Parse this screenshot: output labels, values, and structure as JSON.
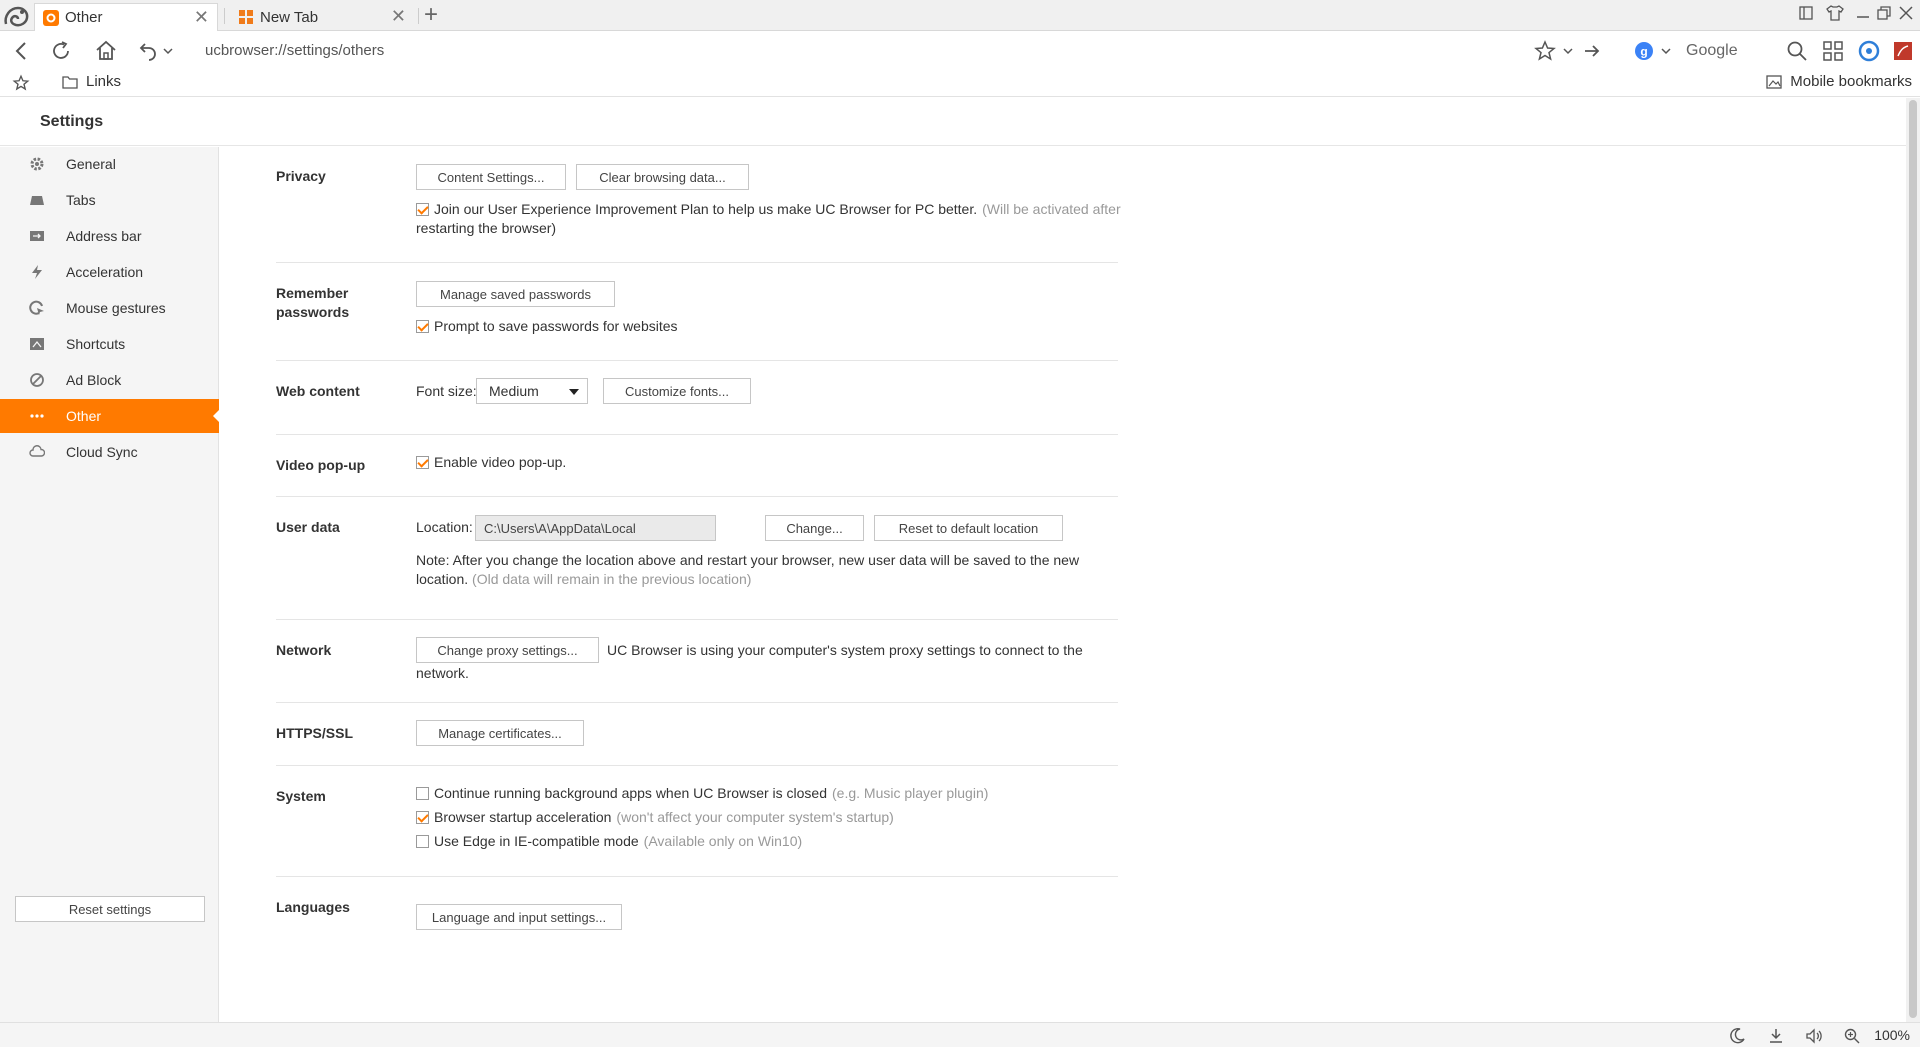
{
  "browser": {
    "tabs": [
      {
        "label": "Other",
        "icon": "gear-icon"
      },
      {
        "label": "New Tab",
        "icon": "grid-icon"
      }
    ],
    "url": "ucbrowser://settings/others",
    "search_engine": "Google",
    "bookmarks_bar": {
      "folder": "Links",
      "mobile": "Mobile bookmarks"
    },
    "status": {
      "zoom": "100%"
    }
  },
  "colors": {
    "accent": "#ff7a00"
  },
  "settings": {
    "title": "Settings",
    "sidebar": [
      {
        "label": "General",
        "icon": "gear-icon"
      },
      {
        "label": "Tabs",
        "icon": "tabs-icon"
      },
      {
        "label": "Address bar",
        "icon": "address-bar-icon"
      },
      {
        "label": "Acceleration",
        "icon": "lightning-icon"
      },
      {
        "label": "Mouse gestures",
        "icon": "mouse-gesture-icon"
      },
      {
        "label": "Shortcuts",
        "icon": "shortcuts-icon"
      },
      {
        "label": "Ad Block",
        "icon": "block-icon"
      },
      {
        "label": "Other",
        "icon": "more-dots-icon",
        "active": true
      },
      {
        "label": "Cloud Sync",
        "icon": "cloud-icon"
      }
    ],
    "reset_label": "Reset settings",
    "sections": {
      "privacy": {
        "label": "Privacy",
        "content_settings": "Content Settings...",
        "clear_data": "Clear browsing data...",
        "ux_plan": "Join our User Experience Improvement Plan to help us make UC Browser for PC better.",
        "ux_plan_note1": "(Will be activated after",
        "ux_plan_note2": "restarting the browser)",
        "ux_plan_checked": true
      },
      "passwords": {
        "label1": "Remember",
        "label2": "passwords",
        "manage": "Manage saved passwords",
        "prompt": "Prompt to save passwords for websites",
        "prompt_checked": true
      },
      "web_content": {
        "label": "Web content",
        "font_size_label": "Font size:",
        "font_size_value": "Medium",
        "customize": "Customize fonts..."
      },
      "video": {
        "label": "Video pop-up",
        "enable": "Enable video pop-up.",
        "enable_checked": true
      },
      "user_data": {
        "label": "User data",
        "location_label": "Location:",
        "location_value": "C:\\Users\\A\\AppData\\Local",
        "change": "Change...",
        "reset": "Reset to default location",
        "note_line1": "Note: After you change the location above and restart your browser, new user data will be saved to the new",
        "note_line2": "location.",
        "note_muted": "(Old data will remain in the previous location)"
      },
      "network": {
        "label": "Network",
        "proxy": "Change proxy settings...",
        "text_line1": "UC Browser is using your computer's system proxy settings to connect to the",
        "text_line2": "network."
      },
      "https": {
        "label": "HTTPS/SSL",
        "certs": "Manage certificates..."
      },
      "system": {
        "label": "System",
        "bg_apps": "Continue running background apps when UC Browser is closed",
        "bg_apps_note": "(e.g. Music player plugin)",
        "bg_apps_checked": false,
        "startup": "Browser startup acceleration",
        "startup_note": "(won't affect your computer system's startup)",
        "startup_checked": true,
        "edge": "Use Edge in IE-compatible mode",
        "edge_note": "(Available only on Win10)",
        "edge_checked": false
      },
      "languages": {
        "label": "Languages",
        "settings": "Language and input settings..."
      }
    }
  }
}
